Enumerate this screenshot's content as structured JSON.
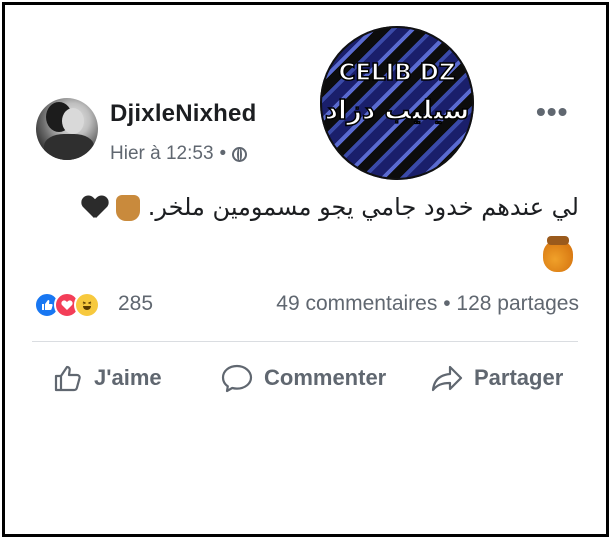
{
  "post": {
    "author": "DjixleNixhed",
    "time": "Hier à 12:53",
    "visibility_icon": "globe-icon",
    "text": "لي عندهم خدود جامي يجو مسمومين ملخر.",
    "more_label": "•••"
  },
  "logo": {
    "top_text": "CELIB DZ",
    "arabic_text": "سيليب دزاد"
  },
  "reactions": {
    "icons": [
      "like-icon",
      "love-icon",
      "haha-icon"
    ],
    "count": "285",
    "comments": "49 commentaires",
    "shares": "128 partages",
    "separator": "•"
  },
  "actions": {
    "like_label": "J'aime",
    "comment_label": "Commenter",
    "share_label": "Partager"
  },
  "colors": {
    "accent": "#1877f2",
    "love": "#f33e58",
    "haha": "#f7c93e",
    "muted_text": "#606770"
  }
}
